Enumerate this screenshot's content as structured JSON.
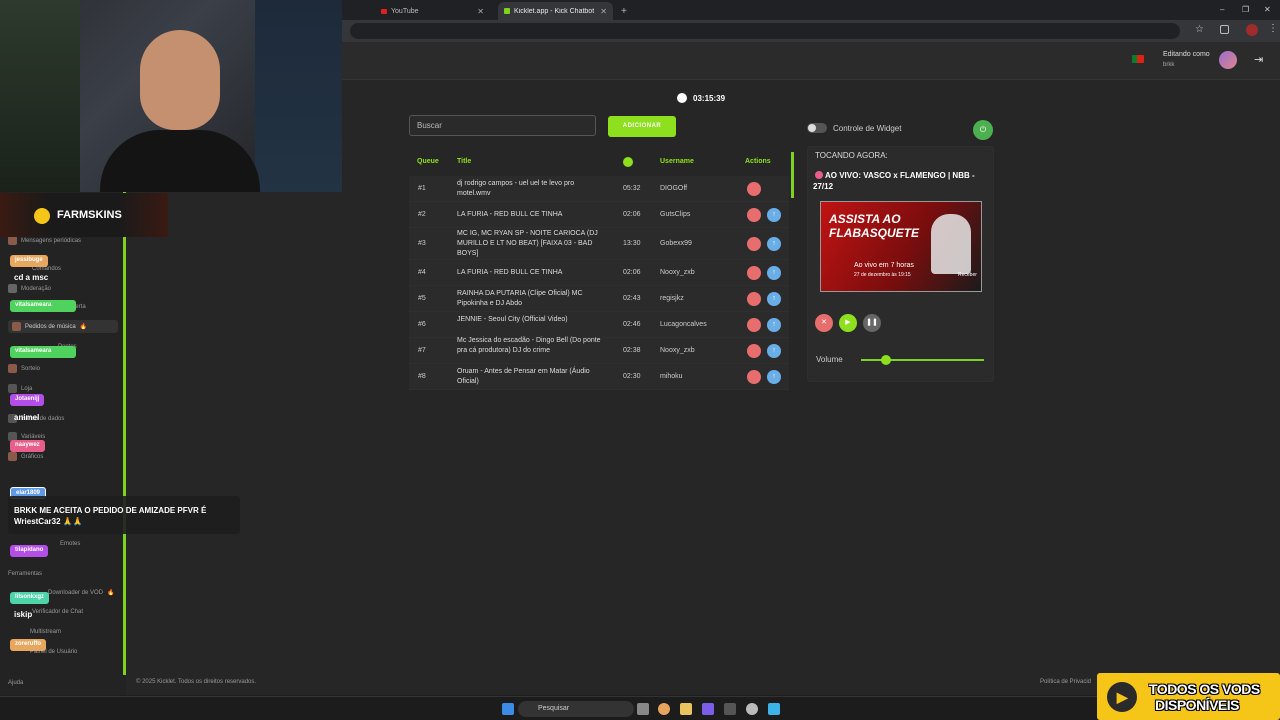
{
  "browser": {
    "tabs": [
      {
        "label": "YouTube"
      },
      {
        "label": "Kicklet.app - Kick Chatbot and"
      }
    ],
    "new_tab": "+",
    "window_controls": [
      "–",
      "❐",
      "✕"
    ]
  },
  "header": {
    "editing_label": "Editando como",
    "user": "brkk"
  },
  "player": {
    "clock": "03:15:39",
    "search_placeholder": "Buscar",
    "add_label": "ADICIONAR",
    "widget_label": "Controle de Widget",
    "now_playing_label": "TOCANDO AGORA:",
    "now_playing_title": "AO VIVO: VASCO x FLAMENGO | NBB - 27/12",
    "thumb_line1": "ASSISTA AO",
    "thumb_line2": "FLABASQUETE",
    "thumb_live": "Ao vivo em 7 horas",
    "thumb_date": "27 de dezembro às 19:15",
    "thumb_receive": "Receber",
    "volume_label": "Volume",
    "volume": 0.2
  },
  "queue": {
    "headers": {
      "queue": "Queue",
      "title": "Title",
      "username": "Username",
      "actions": "Actions"
    },
    "rows": [
      {
        "pos": "#1",
        "title": "dj rodrigo campos - uel uel te levo pro motel.wmv",
        "duration": "05:32",
        "user": "DIOGOff"
      },
      {
        "pos": "#2",
        "title": "LA FURIA - RED BULL CE TINHA",
        "duration": "02:06",
        "user": "GutsClips"
      },
      {
        "pos": "#3",
        "title": "MC IG, MC RYAN SP - NOITE CARIOCA (DJ MURILLO E LT NO BEAT) [FAIXA 03 - BAD BOYS]",
        "duration": "13:30",
        "user": "Gobexx99"
      },
      {
        "pos": "#4",
        "title": "LA FURIA - RED BULL CE TINHA",
        "duration": "02:06",
        "user": "Nooxy_zxb"
      },
      {
        "pos": "#5",
        "title": "RAINHA DA PUTARIA (Clipe Oficial) MC Pipokinha e DJ Abdo",
        "duration": "02:43",
        "user": "regisjkz"
      },
      {
        "pos": "#6",
        "title": "JENNIE - Seoul City (Official Video)",
        "duration": "02:46",
        "user": "Lucagoncalves"
      },
      {
        "pos": "#7",
        "title": "Mc Jessica do escadão - Dingo Bell (Do ponte pra cá produtora) DJ do crime",
        "duration": "02:38",
        "user": "Nooxy_zxb"
      },
      {
        "pos": "#8",
        "title": "Oruam - Antes de Pensar em Matar (Áudio Oficial)",
        "duration": "02:30",
        "user": "mihoku"
      }
    ]
  },
  "sidebar": {
    "items": [
      "Mensagens periódicas",
      "Comandos",
      "Moderação",
      "Alerta",
      "Pedidos de música",
      "Pontos",
      "Sorteio",
      "Loja",
      "Banco de dados",
      "Variáveis",
      "Gráficos",
      "Emotes",
      "Ferramentas",
      "Downloader de VOD",
      "Verificador de Chat",
      "Multistream",
      "Painel de Usuário",
      "Ajuda"
    ]
  },
  "overlay": {
    "sponsor": "FARMSKINS",
    "chat": [
      {
        "name": "jessibuge",
        "msg": "cd a msc",
        "color": "#e8a75e"
      },
      {
        "name": "vitalsameara",
        "msg": "",
        "color": "#4fd35e"
      },
      {
        "name": "vitalsameara",
        "msg": "",
        "color": "#4fd35e"
      },
      {
        "name": "Jotaenijj",
        "msg": "animel",
        "color": "#b44ee8"
      },
      {
        "name": "naaywez",
        "msg": "",
        "color": "#e85e8b"
      },
      {
        "name": "eiar1809",
        "msg": "",
        "color": "#5e9ce8"
      },
      {
        "name": "tilapidano",
        "msg": "",
        "color": "#b44ee8"
      },
      {
        "name": "lilsonkxgz",
        "msg": "iskip",
        "color": "#4fd3a8"
      },
      {
        "name": "zoreruffo",
        "msg": "",
        "color": "#e8a75e"
      }
    ],
    "highlight": "BRKK ME ACEITA O PEDIDO DE AMIZADE PFVR É WriestCar32 🙏🙏"
  },
  "footer": {
    "copyright": "© 2025 Kicklet. Todos os direitos reservados.",
    "privacy": "Política de Privacid"
  },
  "taskbar": {
    "search": "Pesquisar"
  },
  "promo": {
    "line1": "TODOS OS VODS",
    "line2": "DISPONÍVEIS"
  }
}
